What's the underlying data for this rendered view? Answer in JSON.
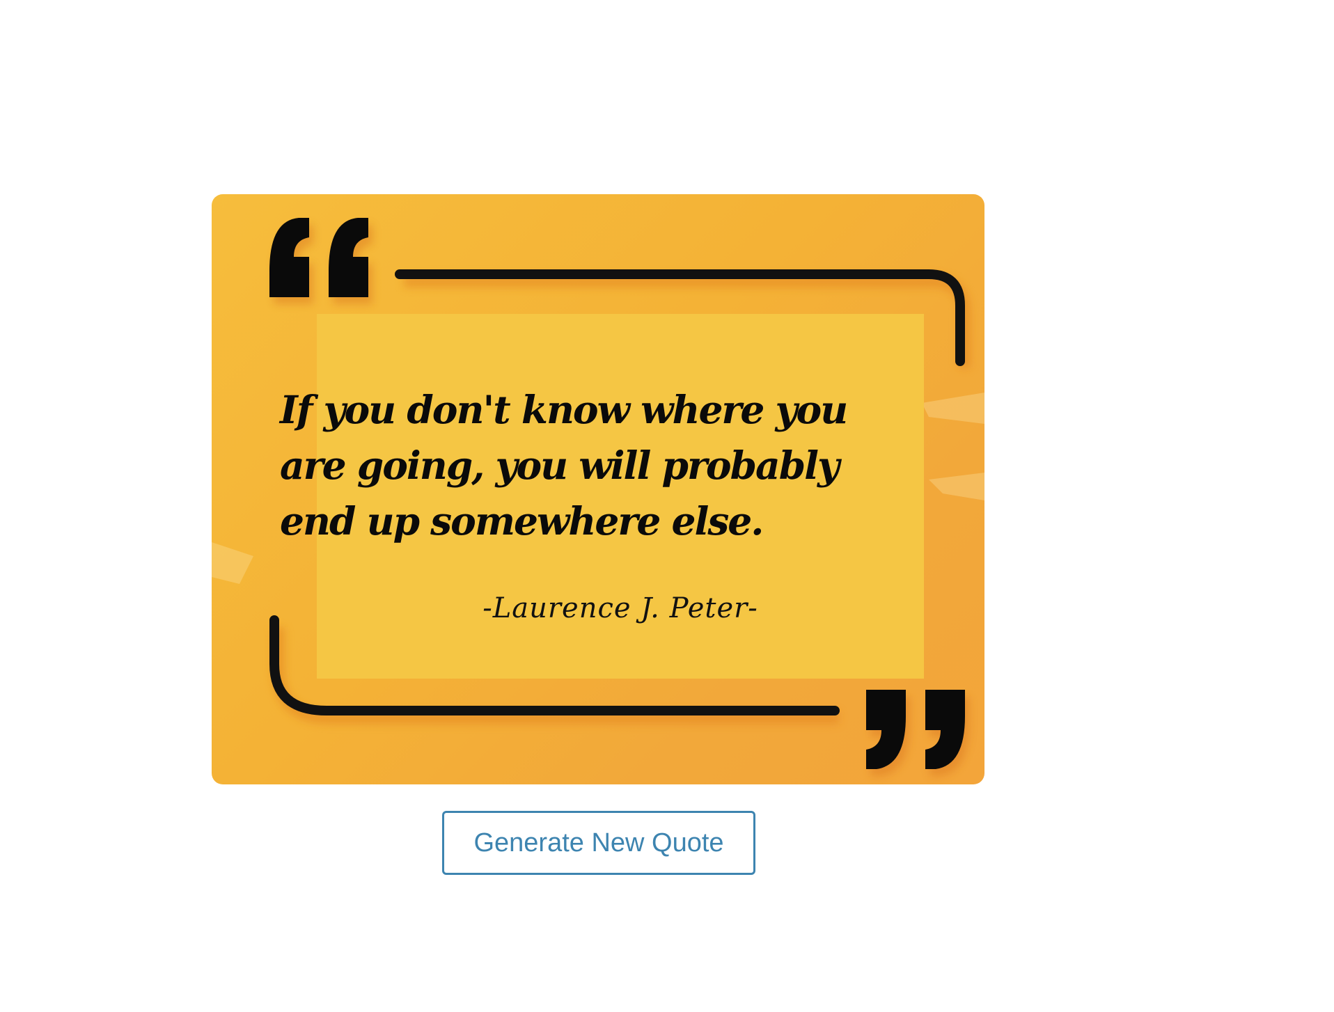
{
  "quote": {
    "text": "If you don't know where you are going, you will probably end up somewhere else.",
    "author": "-Laurence J. Peter-"
  },
  "button": {
    "label": "Generate New Quote"
  },
  "colors": {
    "card_background": "#f4b236",
    "inner_panel": "#f5c644",
    "frame_stroke": "#111111",
    "button_accent": "#3d84b0"
  },
  "icons": {
    "open_quote": "open-quote-icon",
    "close_quote": "close-quote-icon"
  }
}
